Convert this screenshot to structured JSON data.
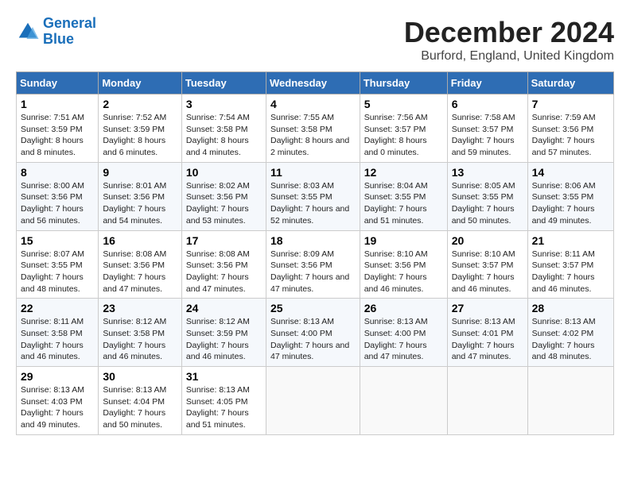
{
  "logo": {
    "line1": "General",
    "line2": "Blue"
  },
  "title": "December 2024",
  "subtitle": "Burford, England, United Kingdom",
  "days_header": [
    "Sunday",
    "Monday",
    "Tuesday",
    "Wednesday",
    "Thursday",
    "Friday",
    "Saturday"
  ],
  "weeks": [
    [
      {
        "day": "1",
        "text": "Sunrise: 7:51 AM\nSunset: 3:59 PM\nDaylight: 8 hours and 8 minutes."
      },
      {
        "day": "2",
        "text": "Sunrise: 7:52 AM\nSunset: 3:59 PM\nDaylight: 8 hours and 6 minutes."
      },
      {
        "day": "3",
        "text": "Sunrise: 7:54 AM\nSunset: 3:58 PM\nDaylight: 8 hours and 4 minutes."
      },
      {
        "day": "4",
        "text": "Sunrise: 7:55 AM\nSunset: 3:58 PM\nDaylight: 8 hours and 2 minutes."
      },
      {
        "day": "5",
        "text": "Sunrise: 7:56 AM\nSunset: 3:57 PM\nDaylight: 8 hours and 0 minutes."
      },
      {
        "day": "6",
        "text": "Sunrise: 7:58 AM\nSunset: 3:57 PM\nDaylight: 7 hours and 59 minutes."
      },
      {
        "day": "7",
        "text": "Sunrise: 7:59 AM\nSunset: 3:56 PM\nDaylight: 7 hours and 57 minutes."
      }
    ],
    [
      {
        "day": "8",
        "text": "Sunrise: 8:00 AM\nSunset: 3:56 PM\nDaylight: 7 hours and 56 minutes."
      },
      {
        "day": "9",
        "text": "Sunrise: 8:01 AM\nSunset: 3:56 PM\nDaylight: 7 hours and 54 minutes."
      },
      {
        "day": "10",
        "text": "Sunrise: 8:02 AM\nSunset: 3:56 PM\nDaylight: 7 hours and 53 minutes."
      },
      {
        "day": "11",
        "text": "Sunrise: 8:03 AM\nSunset: 3:55 PM\nDaylight: 7 hours and 52 minutes."
      },
      {
        "day": "12",
        "text": "Sunrise: 8:04 AM\nSunset: 3:55 PM\nDaylight: 7 hours and 51 minutes."
      },
      {
        "day": "13",
        "text": "Sunrise: 8:05 AM\nSunset: 3:55 PM\nDaylight: 7 hours and 50 minutes."
      },
      {
        "day": "14",
        "text": "Sunrise: 8:06 AM\nSunset: 3:55 PM\nDaylight: 7 hours and 49 minutes."
      }
    ],
    [
      {
        "day": "15",
        "text": "Sunrise: 8:07 AM\nSunset: 3:55 PM\nDaylight: 7 hours and 48 minutes."
      },
      {
        "day": "16",
        "text": "Sunrise: 8:08 AM\nSunset: 3:56 PM\nDaylight: 7 hours and 47 minutes."
      },
      {
        "day": "17",
        "text": "Sunrise: 8:08 AM\nSunset: 3:56 PM\nDaylight: 7 hours and 47 minutes."
      },
      {
        "day": "18",
        "text": "Sunrise: 8:09 AM\nSunset: 3:56 PM\nDaylight: 7 hours and 47 minutes."
      },
      {
        "day": "19",
        "text": "Sunrise: 8:10 AM\nSunset: 3:56 PM\nDaylight: 7 hours and 46 minutes."
      },
      {
        "day": "20",
        "text": "Sunrise: 8:10 AM\nSunset: 3:57 PM\nDaylight: 7 hours and 46 minutes."
      },
      {
        "day": "21",
        "text": "Sunrise: 8:11 AM\nSunset: 3:57 PM\nDaylight: 7 hours and 46 minutes."
      }
    ],
    [
      {
        "day": "22",
        "text": "Sunrise: 8:11 AM\nSunset: 3:58 PM\nDaylight: 7 hours and 46 minutes."
      },
      {
        "day": "23",
        "text": "Sunrise: 8:12 AM\nSunset: 3:58 PM\nDaylight: 7 hours and 46 minutes."
      },
      {
        "day": "24",
        "text": "Sunrise: 8:12 AM\nSunset: 3:59 PM\nDaylight: 7 hours and 46 minutes."
      },
      {
        "day": "25",
        "text": "Sunrise: 8:13 AM\nSunset: 4:00 PM\nDaylight: 7 hours and 47 minutes."
      },
      {
        "day": "26",
        "text": "Sunrise: 8:13 AM\nSunset: 4:00 PM\nDaylight: 7 hours and 47 minutes."
      },
      {
        "day": "27",
        "text": "Sunrise: 8:13 AM\nSunset: 4:01 PM\nDaylight: 7 hours and 47 minutes."
      },
      {
        "day": "28",
        "text": "Sunrise: 8:13 AM\nSunset: 4:02 PM\nDaylight: 7 hours and 48 minutes."
      }
    ],
    [
      {
        "day": "29",
        "text": "Sunrise: 8:13 AM\nSunset: 4:03 PM\nDaylight: 7 hours and 49 minutes."
      },
      {
        "day": "30",
        "text": "Sunrise: 8:13 AM\nSunset: 4:04 PM\nDaylight: 7 hours and 50 minutes."
      },
      {
        "day": "31",
        "text": "Sunrise: 8:13 AM\nSunset: 4:05 PM\nDaylight: 7 hours and 51 minutes."
      },
      {
        "day": "",
        "text": ""
      },
      {
        "day": "",
        "text": ""
      },
      {
        "day": "",
        "text": ""
      },
      {
        "day": "",
        "text": ""
      }
    ]
  ]
}
